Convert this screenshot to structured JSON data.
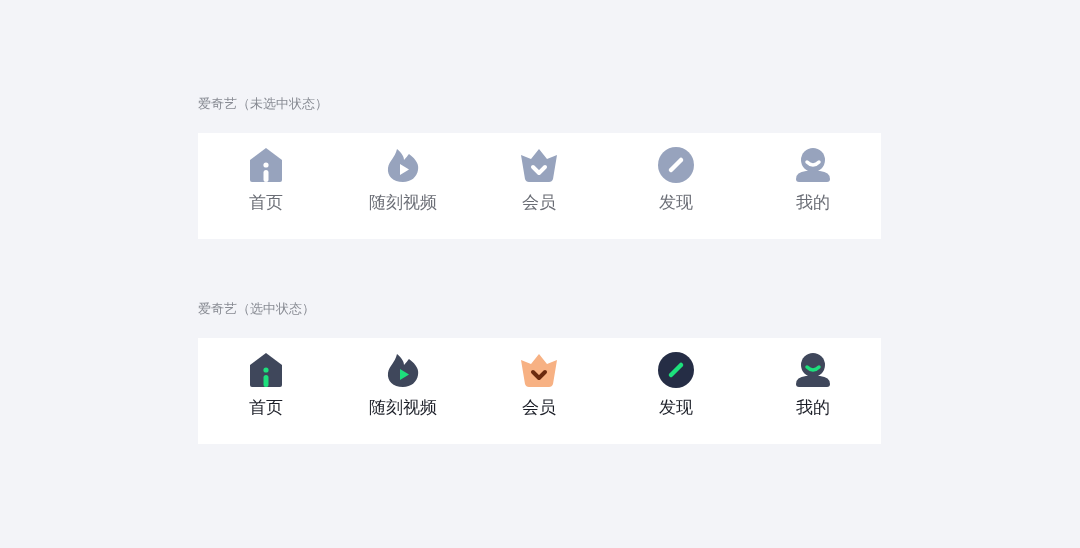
{
  "sections": [
    {
      "caption": "爱奇艺（未选中状态）",
      "tabs": [
        {
          "kind": "home",
          "label": "首页",
          "selected": false
        },
        {
          "kind": "flame",
          "label": "随刻视频",
          "selected": false
        },
        {
          "kind": "crown",
          "label": "会员",
          "selected": false
        },
        {
          "kind": "disc",
          "label": "发现",
          "selected": false
        },
        {
          "kind": "user",
          "label": "我的",
          "selected": false
        }
      ]
    },
    {
      "caption": "爱奇艺（选中状态）",
      "tabs": [
        {
          "kind": "home",
          "label": "首页",
          "selected": true
        },
        {
          "kind": "flame",
          "label": "随刻视频",
          "selected": true
        },
        {
          "kind": "crown",
          "label": "会员",
          "selected": true
        },
        {
          "kind": "disc",
          "label": "发现",
          "selected": true
        },
        {
          "kind": "user",
          "label": "我的",
          "selected": true
        }
      ]
    }
  ]
}
